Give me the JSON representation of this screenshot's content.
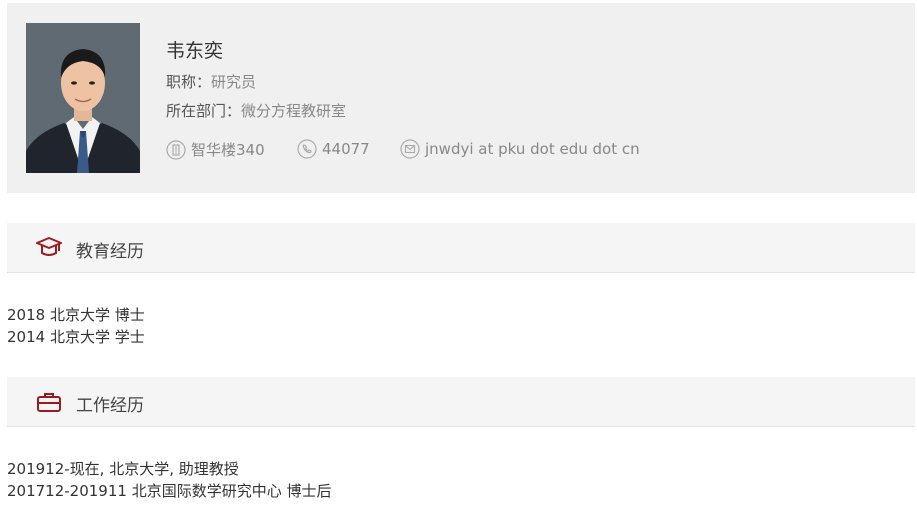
{
  "profile": {
    "name": "韦东奕",
    "title_label": "职称：",
    "title_value": "研究员",
    "dept_label": "所在部门：",
    "dept_value": "微分方程教研室",
    "office": "智华楼340",
    "phone": "44077",
    "email": "jnwdyi at pku dot edu dot cn",
    "icons": {
      "office": "building-icon",
      "phone": "phone-icon",
      "email": "mail-icon"
    }
  },
  "education": {
    "heading": "教育经历",
    "icon": "graduation-cap-icon",
    "items": [
      "2018 北京大学 博士",
      "2014 北京大学 学士"
    ]
  },
  "work": {
    "heading": "工作经历",
    "icon": "briefcase-icon",
    "items": [
      "201912-现在, 北京大学, 助理教授",
      "201712-201911 北京国际数学研究中心 博士后"
    ]
  },
  "colors": {
    "accent": "#9b1b1f",
    "card_bg": "#f0f0f0",
    "muted_text": "#888888"
  }
}
